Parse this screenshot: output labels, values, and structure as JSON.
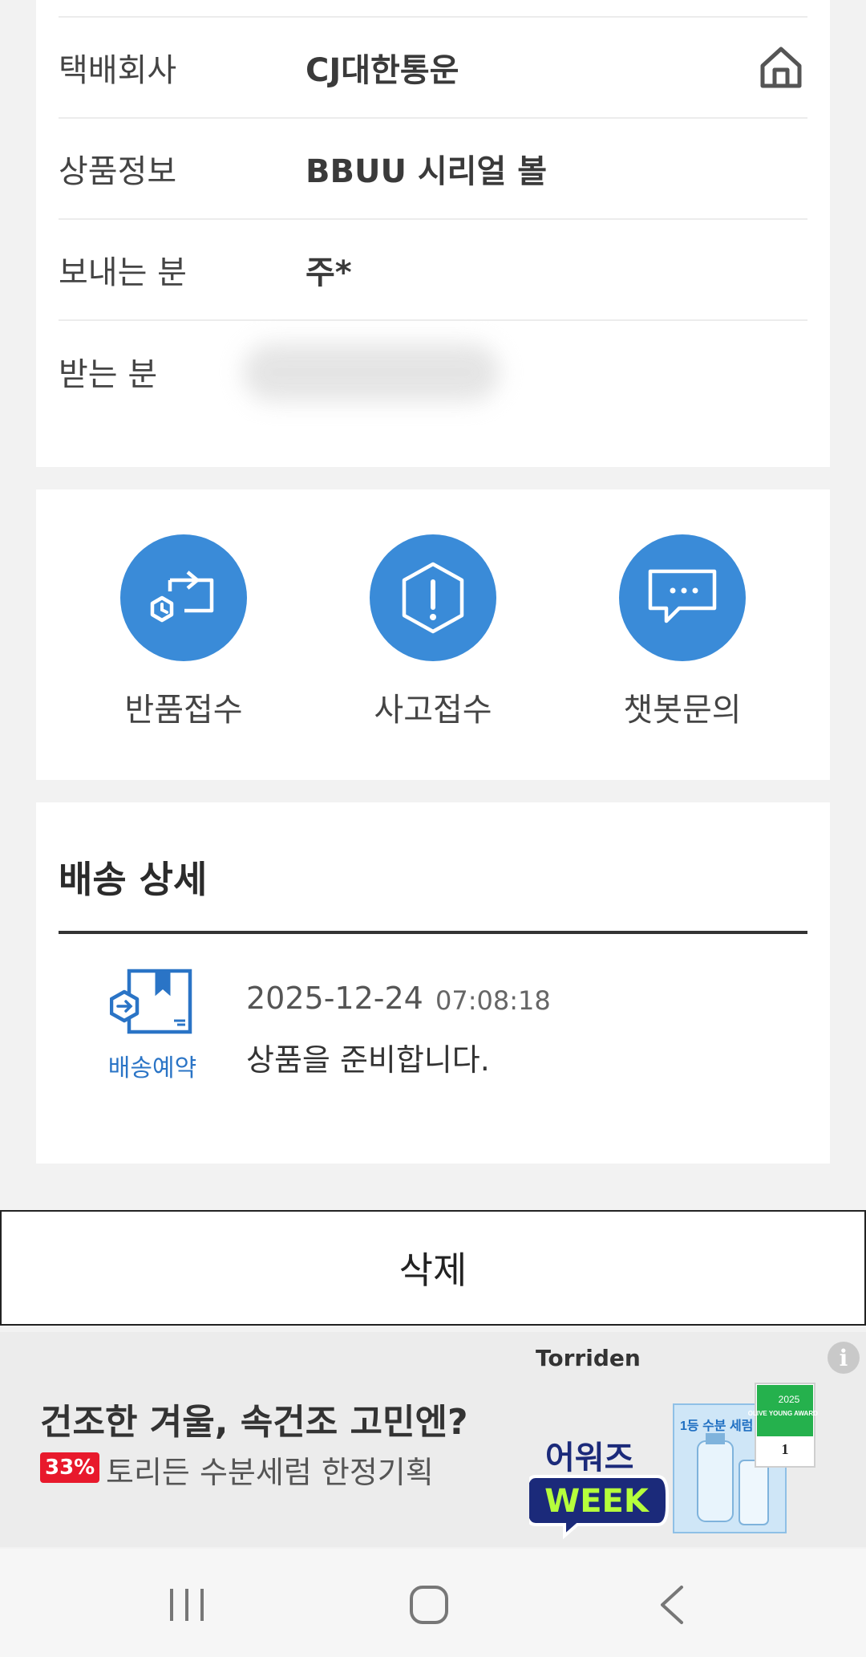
{
  "info": {
    "rows": [
      {
        "label": "택배회사",
        "value": "CJ대한통운"
      },
      {
        "label": "상품정보",
        "value": "BBUU 시리얼 볼"
      },
      {
        "label": "보내는 분",
        "value": "주*"
      },
      {
        "label": "받는 분",
        "value": ""
      }
    ],
    "home_icon": "home-icon"
  },
  "actions": [
    {
      "label": "반품접수",
      "icon": "return-icon"
    },
    {
      "label": "사고접수",
      "icon": "alert-icon"
    },
    {
      "label": "챗봇문의",
      "icon": "chat-icon"
    }
  ],
  "detail": {
    "title": "배송 상세",
    "status_label": "배송예약",
    "date": "2025-12-24",
    "time": "07:08:18",
    "description": "상품을 준비합니다."
  },
  "delete_label": "삭제",
  "ad": {
    "brand": "Torriden",
    "headline": "건조한 겨울, 속건조 고민엔?",
    "badge": "33%",
    "sub": "토리든 수분세럼 한정기획",
    "promo_line1": "어워즈",
    "promo_line2": "WEEK",
    "award_year": "2025",
    "award_text": "OLIVE YOUNG AWARDS",
    "product_text": "1등 수분 세럼"
  },
  "colors": {
    "accent_blue": "#3a8bd8",
    "status_blue": "#2a74c6",
    "badge_red": "#e8192c"
  },
  "nav": [
    "recent-apps-icon",
    "home-nav-icon",
    "back-icon"
  ]
}
